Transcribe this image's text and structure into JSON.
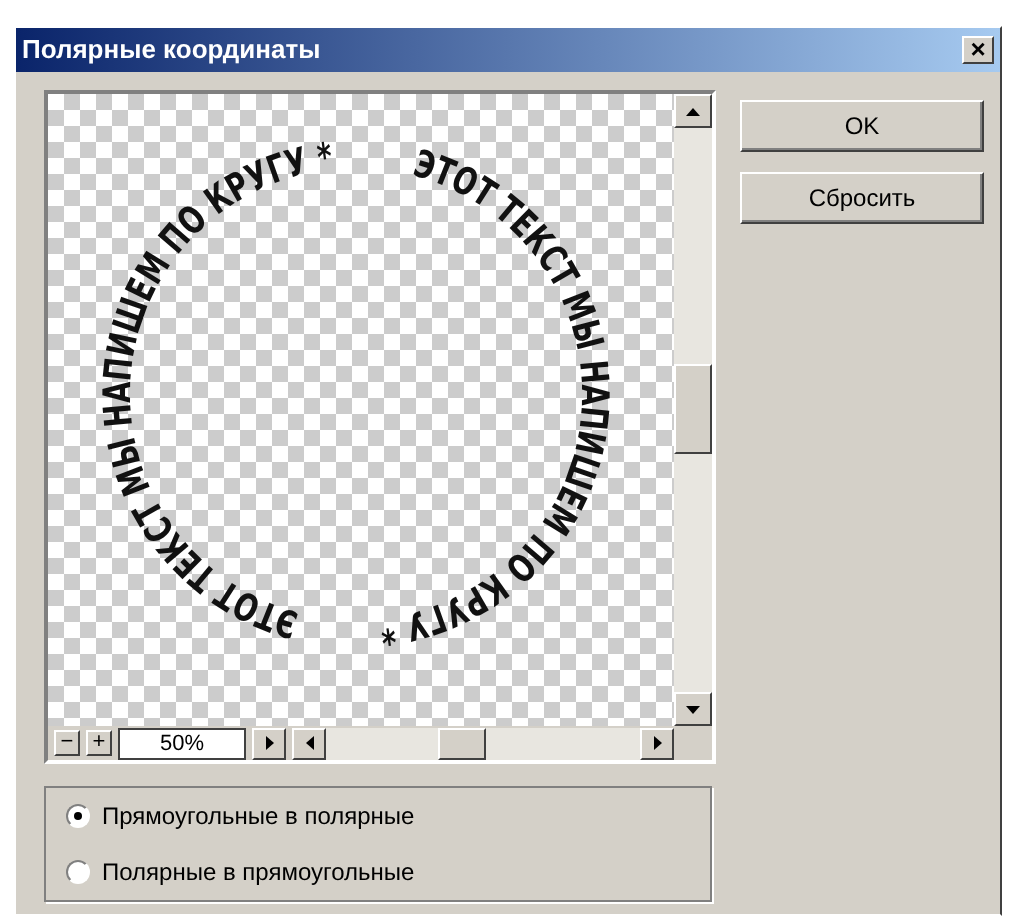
{
  "window": {
    "title": "Полярные координаты",
    "close": "×"
  },
  "preview": {
    "texts": [
      "ЭТОТ ТЕКСТ МЫ НАПИШЕМ ПО КРУГУ *",
      "ЭТОТ ТЕКСТ МЫ НАПИШЕМ ПО КРУГУ *"
    ],
    "zoom_out": "−",
    "zoom_in": "+",
    "zoom": "50%"
  },
  "buttons": [
    {
      "label": "OK"
    },
    {
      "label": "Сбросить"
    }
  ],
  "options": [
    {
      "label": "Прямоугольные в полярные",
      "selected": true
    },
    {
      "label": "Полярные в прямоугольные",
      "selected": false
    }
  ]
}
